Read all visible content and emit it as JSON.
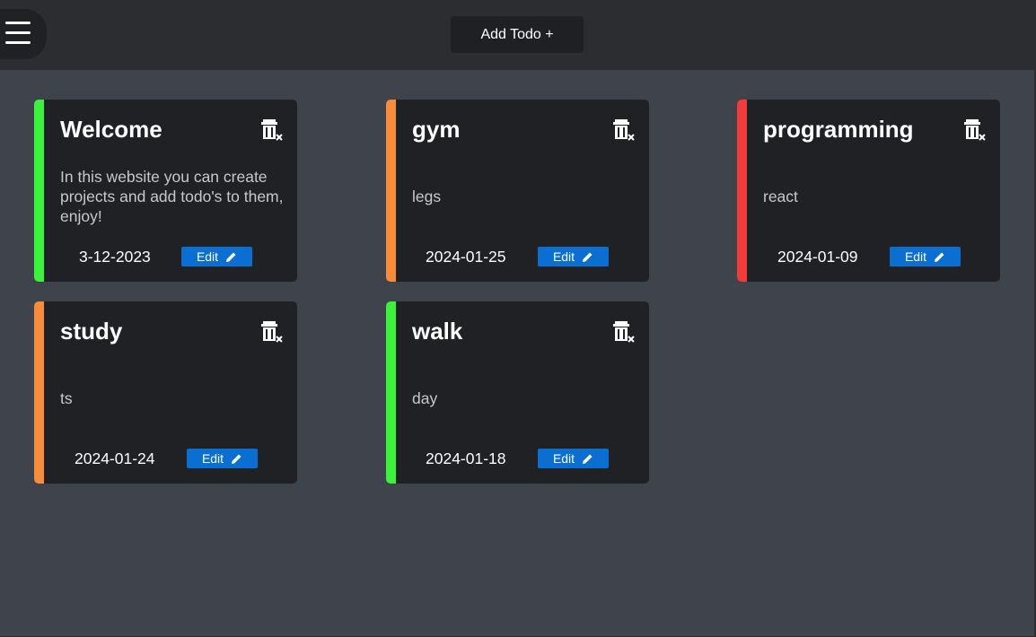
{
  "header": {
    "add_button_label": "Add Todo +"
  },
  "colors": {
    "high": "#3cf23c",
    "medium": "#f78c3b",
    "urgent": "#f23c3c",
    "edit_button": "#0a6fd1"
  },
  "todos": [
    {
      "title": "Welcome",
      "description": "In this website you can create projects and add todo's to them, enjoy!",
      "date": "3-12-2023",
      "edit_label": "Edit",
      "priority_color": "#3cf23c"
    },
    {
      "title": "gym",
      "description": "legs",
      "date": "2024-01-25",
      "edit_label": "Edit",
      "priority_color": "#f78c3b"
    },
    {
      "title": "programming",
      "description": "react",
      "date": "2024-01-09",
      "edit_label": "Edit",
      "priority_color": "#f23c3c"
    },
    {
      "title": "study",
      "description": "ts",
      "date": "2024-01-24",
      "edit_label": "Edit",
      "priority_color": "#f78c3b"
    },
    {
      "title": "walk",
      "description": "day",
      "date": "2024-01-18",
      "edit_label": "Edit",
      "priority_color": "#3cf23c"
    }
  ]
}
